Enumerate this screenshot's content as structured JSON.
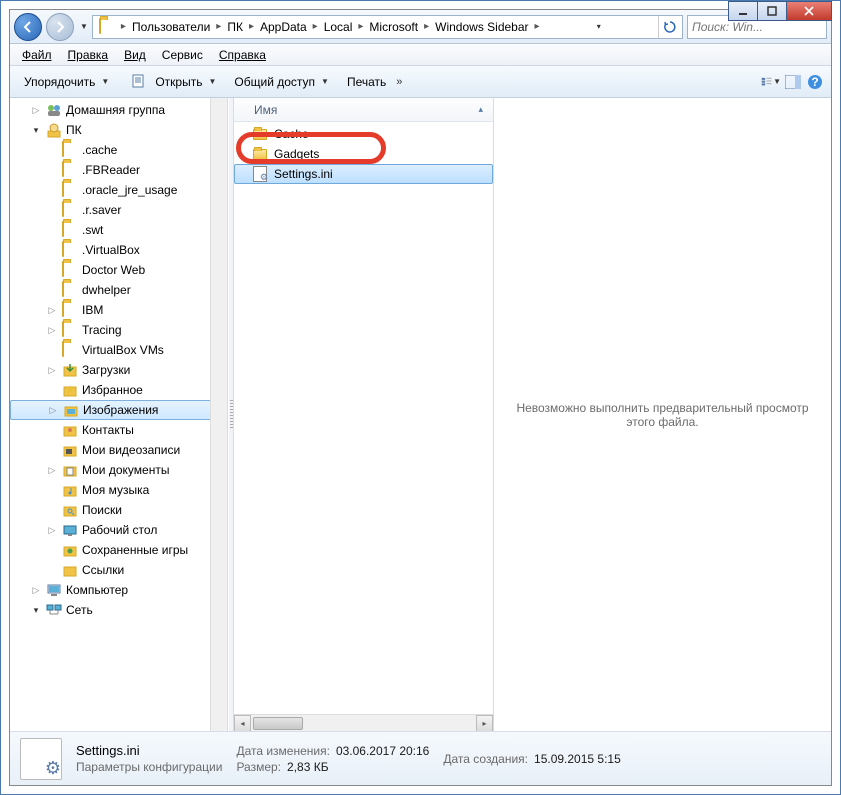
{
  "titlebar": {
    "minimize": "_",
    "maximize": "▢",
    "close": "✕"
  },
  "breadcrumbs": [
    "Пользователи",
    "ПК",
    "AppData",
    "Local",
    "Microsoft",
    "Windows Sidebar"
  ],
  "search": {
    "placeholder": "Поиск: Win..."
  },
  "menu": {
    "file": "Файл",
    "edit": "Правка",
    "view": "Вид",
    "tools": "Сервис",
    "help": "Справка"
  },
  "toolbar": {
    "organize": "Упорядочить",
    "open": "Открыть",
    "share": "Общий доступ",
    "print": "Печать"
  },
  "tree": [
    {
      "depth": 1,
      "exp": "▷",
      "icon": "homegroup",
      "label": "Домашняя группа"
    },
    {
      "depth": 1,
      "exp": "▾",
      "icon": "user",
      "label": "ПК"
    },
    {
      "depth": 2,
      "exp": "",
      "icon": "folder",
      "label": ".cache"
    },
    {
      "depth": 2,
      "exp": "",
      "icon": "folder",
      "label": ".FBReader"
    },
    {
      "depth": 2,
      "exp": "",
      "icon": "folder",
      "label": ".oracle_jre_usage"
    },
    {
      "depth": 2,
      "exp": "",
      "icon": "folder",
      "label": ".r.saver"
    },
    {
      "depth": 2,
      "exp": "",
      "icon": "folder",
      "label": ".swt"
    },
    {
      "depth": 2,
      "exp": "",
      "icon": "folder",
      "label": ".VirtualBox"
    },
    {
      "depth": 2,
      "exp": "",
      "icon": "folder",
      "label": "Doctor Web"
    },
    {
      "depth": 2,
      "exp": "",
      "icon": "folder",
      "label": "dwhelper"
    },
    {
      "depth": 2,
      "exp": "▷",
      "icon": "folder",
      "label": "IBM"
    },
    {
      "depth": 2,
      "exp": "▷",
      "icon": "folder",
      "label": "Tracing"
    },
    {
      "depth": 2,
      "exp": "",
      "icon": "folder",
      "label": "VirtualBox VMs"
    },
    {
      "depth": 2,
      "exp": "▷",
      "icon": "downloads",
      "label": "Загрузки"
    },
    {
      "depth": 2,
      "exp": "",
      "icon": "favorites",
      "label": "Избранное"
    },
    {
      "depth": 2,
      "exp": "▷",
      "icon": "pictures",
      "label": "Изображения",
      "selected": true
    },
    {
      "depth": 2,
      "exp": "",
      "icon": "contacts",
      "label": "Контакты"
    },
    {
      "depth": 2,
      "exp": "",
      "icon": "videos",
      "label": "Мои видеозаписи"
    },
    {
      "depth": 2,
      "exp": "▷",
      "icon": "documents",
      "label": "Мои документы"
    },
    {
      "depth": 2,
      "exp": "",
      "icon": "music",
      "label": "Моя музыка"
    },
    {
      "depth": 2,
      "exp": "",
      "icon": "search",
      "label": "Поиски"
    },
    {
      "depth": 2,
      "exp": "▷",
      "icon": "desktop",
      "label": "Рабочий стол"
    },
    {
      "depth": 2,
      "exp": "",
      "icon": "saved-games",
      "label": "Сохраненные игры"
    },
    {
      "depth": 2,
      "exp": "",
      "icon": "links",
      "label": "Ссылки"
    },
    {
      "depth": 1,
      "exp": "▷",
      "icon": "computer",
      "label": "Компьютер"
    },
    {
      "depth": 1,
      "exp": "▾",
      "icon": "network",
      "label": "Сеть"
    }
  ],
  "list": {
    "header": "Имя",
    "items": [
      {
        "icon": "folder",
        "label": "Cache"
      },
      {
        "icon": "folder",
        "label": "Gadgets"
      },
      {
        "icon": "ini",
        "label": "Settings.ini",
        "selected": true,
        "highlighted": true
      }
    ]
  },
  "preview": {
    "message": "Невозможно выполнить предварительный просмотр этого файла."
  },
  "details": {
    "filename": "Settings.ini",
    "filetype": "Параметры конфигурации",
    "modified_label": "Дата изменения:",
    "modified_value": "03.06.2017 20:16",
    "size_label": "Размер:",
    "size_value": "2,83 КБ",
    "created_label": "Дата создания:",
    "created_value": "15.09.2015 5:15"
  }
}
